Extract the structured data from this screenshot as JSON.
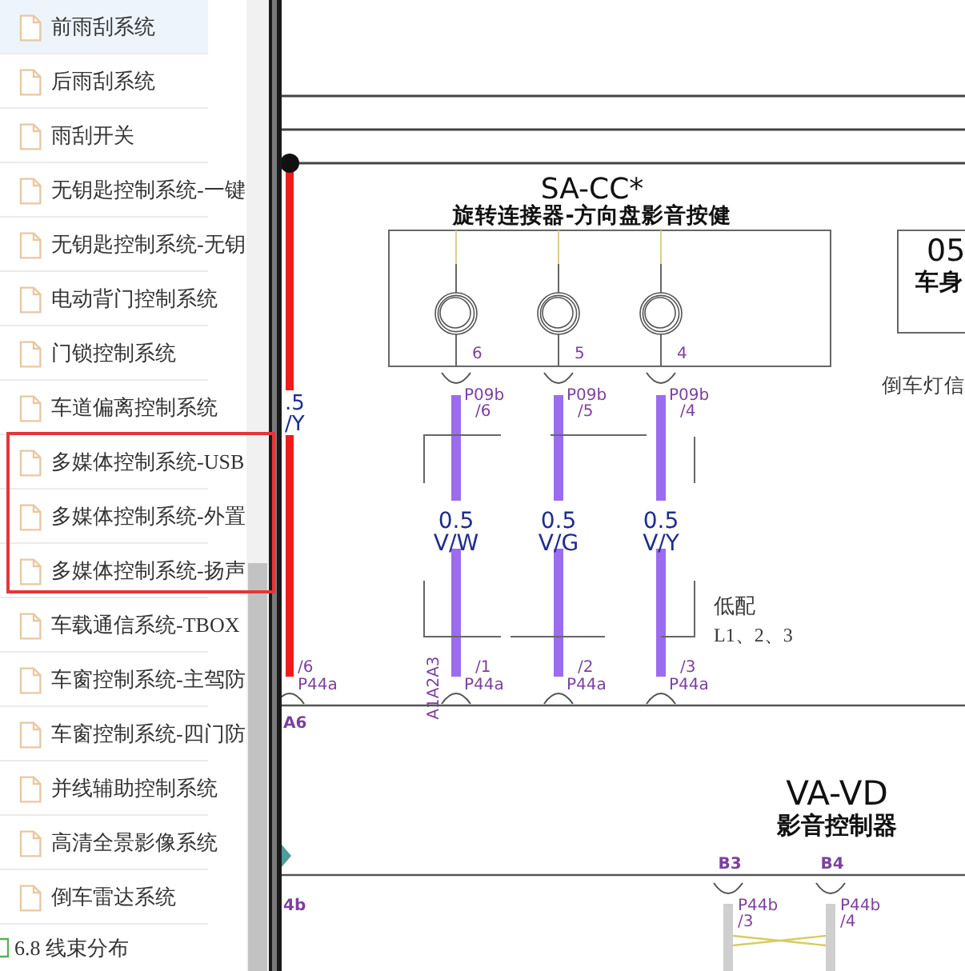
{
  "sidebar": {
    "items": [
      {
        "label": "前雨刮系统",
        "selected": true,
        "marked": false
      },
      {
        "label": "后雨刮系统",
        "selected": false,
        "marked": false
      },
      {
        "label": "雨刮开关",
        "selected": false,
        "marked": false
      },
      {
        "label": "无钥匙控制系统-一键",
        "selected": false,
        "marked": false
      },
      {
        "label": "无钥匙控制系统-无钥",
        "selected": false,
        "marked": false
      },
      {
        "label": "电动背门控制系统",
        "selected": false,
        "marked": false
      },
      {
        "label": "门锁控制系统",
        "selected": false,
        "marked": false
      },
      {
        "label": "车道偏离控制系统",
        "selected": false,
        "marked": false
      },
      {
        "label": "多媒体控制系统-USB",
        "selected": false,
        "marked": true
      },
      {
        "label": "多媒体控制系统-外置",
        "selected": false,
        "marked": true
      },
      {
        "label": "多媒体控制系统-扬声",
        "selected": false,
        "marked": true
      },
      {
        "label": "车载通信系统-TBOX",
        "selected": false,
        "marked": false
      },
      {
        "label": "车窗控制系统-主驾防",
        "selected": false,
        "marked": false
      },
      {
        "label": "车窗控制系统-四门防",
        "selected": false,
        "marked": false
      },
      {
        "label": "并线辅助控制系统",
        "selected": false,
        "marked": false
      },
      {
        "label": "高清全景影像系统",
        "selected": false,
        "marked": false
      },
      {
        "label": "倒车雷达系统",
        "selected": false,
        "marked": false
      }
    ],
    "section": {
      "label": "6.8 线束分布"
    }
  },
  "diagram": {
    "top_module": {
      "code": "SA-CC*",
      "name": "旋转连接器-方向盘影音按健",
      "pins": [
        "6",
        "5",
        "4"
      ]
    },
    "side_module": {
      "code": "05",
      "name": "车身",
      "note": "倒车灯信"
    },
    "feed_wire": {
      "color": "#ee1c1c",
      "gauge": ".5",
      "code": "/Y",
      "pin": "/6",
      "connector": "P44a",
      "terminal": "A6",
      "next_connector": "4b"
    },
    "signal_wires": [
      {
        "color": "#9b6cf0",
        "top_connector": "P09b",
        "top_pin": "/6",
        "gauge": "0.5",
        "code": "V/W",
        "bottom_pin": "/1",
        "bottom_connector": "P44a"
      },
      {
        "color": "#9b6cf0",
        "top_connector": "P09b",
        "top_pin": "/5",
        "gauge": "0.5",
        "code": "V/G",
        "bottom_pin": "/2",
        "bottom_connector": "P44a"
      },
      {
        "color": "#9b6cf0",
        "top_connector": "P09b",
        "top_pin": "/4",
        "gauge": "0.5",
        "code": "V/Y",
        "bottom_pin": "/3",
        "bottom_connector": "P44a"
      }
    ],
    "option_group": {
      "title": "低配",
      "variants": "L1、2、3"
    },
    "terminals": "A1A2A3",
    "bottom_module": {
      "code": "VA-VD",
      "name": "影音控制器",
      "pins": [
        "B3",
        "B4"
      ],
      "twisted_pair": true,
      "wires": [
        {
          "color": "#cfcfcf",
          "connector": "P44b",
          "pin": "/3"
        },
        {
          "color": "#cfcfcf",
          "connector": "P44b",
          "pin": "/4"
        }
      ]
    }
  }
}
